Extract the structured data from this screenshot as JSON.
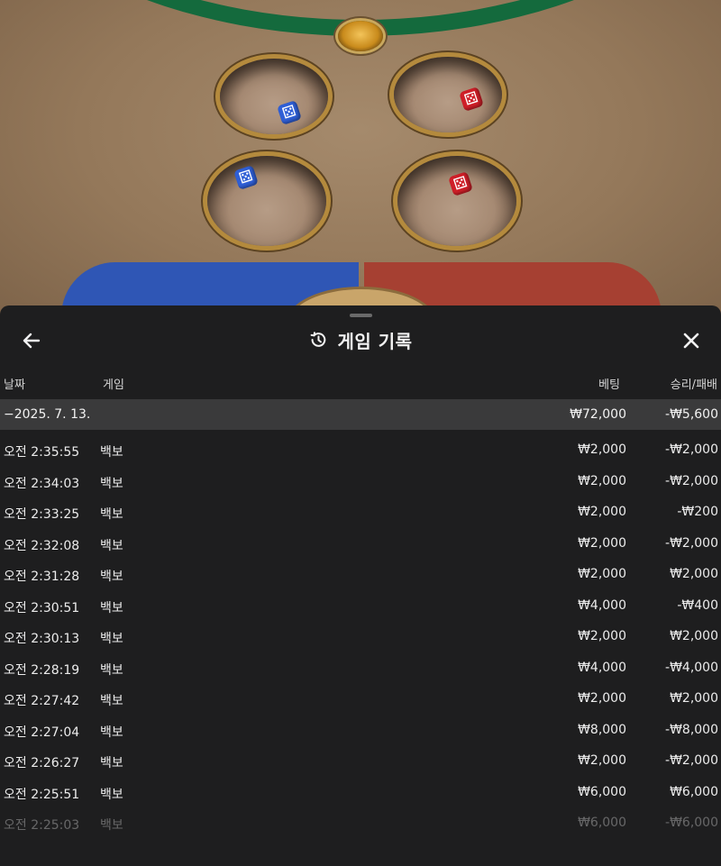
{
  "header": {
    "title": "게임 기록",
    "back_icon": "arrow-left-icon",
    "history_icon": "history-clock-icon",
    "close_icon": "close-icon"
  },
  "columns": {
    "date": "날짜",
    "game": "게임",
    "bet": "베팅",
    "result": "승리/패배"
  },
  "day_summary": {
    "date": "−2025. 7. 13.",
    "bet": "₩72,000",
    "result": "-₩5,600"
  },
  "rows": [
    {
      "time": "오전 2:35:55",
      "game": "백보",
      "bet": "₩2,000",
      "result": "-₩2,000"
    },
    {
      "time": "오전 2:34:03",
      "game": "백보",
      "bet": "₩2,000",
      "result": "-₩2,000"
    },
    {
      "time": "오전 2:33:25",
      "game": "백보",
      "bet": "₩2,000",
      "result": "-₩200"
    },
    {
      "time": "오전 2:32:08",
      "game": "백보",
      "bet": "₩2,000",
      "result": "-₩2,000"
    },
    {
      "time": "오전 2:31:28",
      "game": "백보",
      "bet": "₩2,000",
      "result": "₩2,000"
    },
    {
      "time": "오전 2:30:51",
      "game": "백보",
      "bet": "₩4,000",
      "result": "-₩400"
    },
    {
      "time": "오전 2:30:13",
      "game": "백보",
      "bet": "₩2,000",
      "result": "₩2,000"
    },
    {
      "time": "오전 2:28:19",
      "game": "백보",
      "bet": "₩4,000",
      "result": "-₩4,000"
    },
    {
      "time": "오전 2:27:42",
      "game": "백보",
      "bet": "₩2,000",
      "result": "₩2,000"
    },
    {
      "time": "오전 2:27:04",
      "game": "백보",
      "bet": "₩8,000",
      "result": "-₩8,000"
    },
    {
      "time": "오전 2:26:27",
      "game": "백보",
      "bet": "₩2,000",
      "result": "-₩2,000"
    },
    {
      "time": "오전 2:25:51",
      "game": "백보",
      "bet": "₩6,000",
      "result": "₩6,000"
    },
    {
      "time": "오전 2:25:03",
      "game": "백보",
      "bet": "₩6,000",
      "result": "-₩6,000"
    }
  ],
  "colors": {
    "sheet_bg": "#1e1e1f",
    "day_row_bg": "#3a3a3b",
    "felt_green": "#146a3d",
    "blue_zone": "#2f56b5",
    "red_zone": "#a64032"
  }
}
